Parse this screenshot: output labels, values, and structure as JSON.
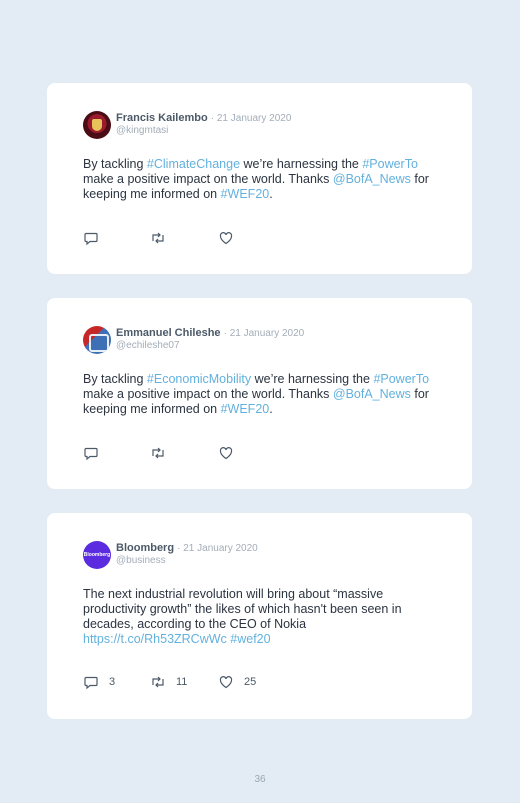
{
  "tweets": [
    {
      "name": "Francis Kailembo",
      "date": "· 21 January 2020",
      "handle": "@kingmtasi",
      "segments": [
        {
          "t": "By tackling "
        },
        {
          "t": "#ClimateChange",
          "link": true
        },
        {
          "t": " we’re harnessing the "
        },
        {
          "t": "#PowerTo",
          "link": true
        },
        {
          "t": " make a positive impact on the world. Thanks "
        },
        {
          "t": "@BofA_News",
          "link": true
        },
        {
          "t": " for keeping me informed on "
        },
        {
          "t": "#WEF20",
          "link": true
        },
        {
          "t": "."
        }
      ],
      "counts": {
        "replies": "",
        "retweets": "",
        "likes": ""
      }
    },
    {
      "name": "Emmanuel Chileshe",
      "date": "· 21 January 2020",
      "handle": "@echileshe07",
      "segments": [
        {
          "t": "By tackling "
        },
        {
          "t": "#EconomicMobility",
          "link": true
        },
        {
          "t": " we’re harnessing the "
        },
        {
          "t": "#PowerTo",
          "link": true
        },
        {
          "t": " make a positive impact on the world. Thanks "
        },
        {
          "t": "@BofA_News",
          "link": true
        },
        {
          "t": " for keeping me informed on "
        },
        {
          "t": "#WEF20",
          "link": true
        },
        {
          "t": "."
        }
      ],
      "counts": {
        "replies": "",
        "retweets": "",
        "likes": ""
      }
    },
    {
      "name": "Bloomberg",
      "date": "· 21 January 2020",
      "handle": "@business",
      "avatar_text": "Bloomberg",
      "segments": [
        {
          "t": "The next industrial revolution will bring about “massive productivity growth” the likes of which hasn't been seen in decades, according to the CEO of Nokia "
        },
        {
          "t": "https://t.co/Rh53ZRCwWc",
          "link": true
        },
        {
          "t": " "
        },
        {
          "t": "#wef20",
          "link": true
        }
      ],
      "counts": {
        "replies": "3",
        "retweets": "11",
        "likes": "25"
      }
    }
  ],
  "page_number": "36",
  "colors": {
    "link": "#62b1de",
    "background": "#e3ecf5",
    "card": "#ffffff"
  }
}
